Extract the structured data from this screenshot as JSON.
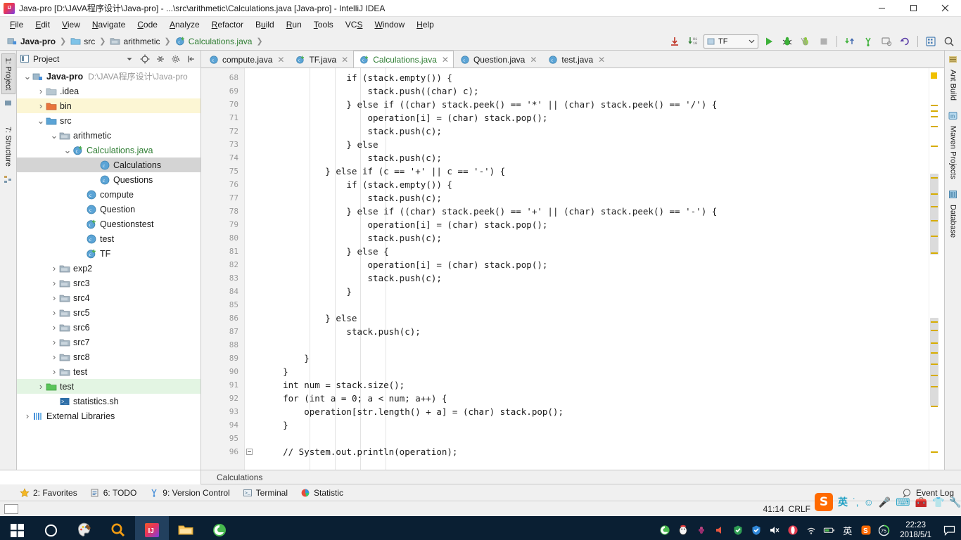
{
  "window": {
    "title": "Java-pro [D:\\JAVA程序设计\\Java-pro] - ...\\src\\arithmetic\\Calculations.java [Java-pro] - IntelliJ IDEA",
    "minimize": "–",
    "maximize": "□",
    "close": "✕"
  },
  "menu": [
    {
      "label": "File",
      "mnemonic": "F"
    },
    {
      "label": "Edit",
      "mnemonic": "E"
    },
    {
      "label": "View",
      "mnemonic": "V"
    },
    {
      "label": "Navigate",
      "mnemonic": "N"
    },
    {
      "label": "Code",
      "mnemonic": "C"
    },
    {
      "label": "Analyze",
      "mnemonic": "A"
    },
    {
      "label": "Refactor",
      "mnemonic": "R"
    },
    {
      "label": "Build",
      "mnemonic": "u"
    },
    {
      "label": "Run",
      "mnemonic": "R"
    },
    {
      "label": "Tools",
      "mnemonic": "T"
    },
    {
      "label": "VCS",
      "mnemonic": "S"
    },
    {
      "label": "Window",
      "mnemonic": "W"
    },
    {
      "label": "Help",
      "mnemonic": "H"
    }
  ],
  "breadcrumb": [
    {
      "label": "Java-pro",
      "icon": "module-icon"
    },
    {
      "label": "src",
      "icon": "source-folder-icon"
    },
    {
      "label": "arithmetic",
      "icon": "package-icon"
    },
    {
      "label": "Calculations.java",
      "icon": "java-class-icon"
    }
  ],
  "toolbar": {
    "run_config": "TF",
    "icons": [
      "update-project-icon",
      "compile-icon",
      "run-icon",
      "debug-icon",
      "coverage-icon",
      "stop-icon",
      "update-icon",
      "commit-icon",
      "history-icon",
      "rollback-icon",
      "settings-icon",
      "search-everywhere-icon"
    ]
  },
  "left_rail": [
    {
      "label": "1: Project",
      "active": true
    },
    {
      "label": "7: Structure",
      "active": false
    }
  ],
  "right_rail": [
    {
      "label": "Ant Build"
    },
    {
      "label": "Maven Projects"
    },
    {
      "label": "Database"
    }
  ],
  "project_panel": {
    "title": "Project",
    "tree": [
      {
        "indent": 0,
        "arrow": "v",
        "icon": "module-icon",
        "label": "Java-pro",
        "path": "D:\\JAVA程序设计\\Java-pro",
        "bold": true
      },
      {
        "indent": 1,
        "arrow": ">",
        "icon": "folder-icon",
        "label": ".idea"
      },
      {
        "indent": 1,
        "arrow": ">",
        "icon": "folder-orange-icon",
        "label": "bin",
        "highlight": "yellow"
      },
      {
        "indent": 1,
        "arrow": "v",
        "icon": "folder-blue-icon",
        "label": "src"
      },
      {
        "indent": 2,
        "arrow": "v",
        "icon": "package-icon",
        "label": "arithmetic"
      },
      {
        "indent": 3,
        "arrow": "v",
        "icon": "java-class-icon",
        "label": "Calculations.java",
        "green": true
      },
      {
        "indent": 5,
        "arrow": "",
        "icon": "class-icon",
        "label": "Calculations",
        "selected": true
      },
      {
        "indent": 5,
        "arrow": "",
        "icon": "class-icon",
        "label": "Questions"
      },
      {
        "indent": 4,
        "arrow": "",
        "icon": "class-icon",
        "label": "compute"
      },
      {
        "indent": 4,
        "arrow": "",
        "icon": "class-icon",
        "label": "Question"
      },
      {
        "indent": 4,
        "arrow": "",
        "icon": "java-class-icon",
        "label": "Questionstest"
      },
      {
        "indent": 4,
        "arrow": "",
        "icon": "class-icon",
        "label": "test"
      },
      {
        "indent": 4,
        "arrow": "",
        "icon": "java-class-icon",
        "label": "TF"
      },
      {
        "indent": 2,
        "arrow": ">",
        "icon": "package-icon",
        "label": "exp2"
      },
      {
        "indent": 2,
        "arrow": ">",
        "icon": "package-icon",
        "label": "src3"
      },
      {
        "indent": 2,
        "arrow": ">",
        "icon": "package-icon",
        "label": "src4"
      },
      {
        "indent": 2,
        "arrow": ">",
        "icon": "package-icon",
        "label": "src5"
      },
      {
        "indent": 2,
        "arrow": ">",
        "icon": "package-icon",
        "label": "src6"
      },
      {
        "indent": 2,
        "arrow": ">",
        "icon": "package-icon",
        "label": "src7"
      },
      {
        "indent": 2,
        "arrow": ">",
        "icon": "package-icon",
        "label": "src8"
      },
      {
        "indent": 2,
        "arrow": ">",
        "icon": "package-icon",
        "label": "test"
      },
      {
        "indent": 1,
        "arrow": ">",
        "icon": "folder-green-icon",
        "label": "test",
        "highlight": "green"
      },
      {
        "indent": 2,
        "arrow": "",
        "icon": "shell-script-icon",
        "label": "statistics.sh"
      },
      {
        "indent": 0,
        "arrow": ">",
        "icon": "library-icon",
        "label": "External Libraries"
      }
    ]
  },
  "editor_tabs": [
    {
      "label": "compute.java",
      "icon": "class-icon",
      "active": false
    },
    {
      "label": "TF.java",
      "icon": "java-class-icon",
      "active": false
    },
    {
      "label": "Calculations.java",
      "icon": "java-class-icon",
      "active": true,
      "green": true
    },
    {
      "label": "Question.java",
      "icon": "class-icon",
      "active": false
    },
    {
      "label": "test.java",
      "icon": "class-icon",
      "active": false
    }
  ],
  "code": {
    "first_line": 68,
    "lines": [
      {
        "n": 68,
        "html": "                <kw>if</kw> (stack.empty()) {"
      },
      {
        "n": 69,
        "html": "                    <hi>stack.push</hi>((<kw>char</kw>) c);"
      },
      {
        "n": 70,
        "html": "                } <kw>else if</kw> ((<kw>char</kw>) stack.peek() == <str>'*'</str> || (<kw>char</kw>) stack.peek() == <str>'/'</str>) {"
      },
      {
        "n": 71,
        "html": "                    operation[i] = (<kw>char</kw>) stack.pop();"
      },
      {
        "n": 72,
        "html": "                    <hi>stack.push</hi>(c);"
      },
      {
        "n": 73,
        "html": "                } <kw>else</kw>"
      },
      {
        "n": 74,
        "html": "                    <hi>stack.push</hi>(c);"
      },
      {
        "n": 75,
        "html": "            } <kw>else if</kw> (c == <str>'+'</str> || c == <str>'-'</str>) {"
      },
      {
        "n": 76,
        "html": "                <kw>if</kw> (stack.empty()) {"
      },
      {
        "n": 77,
        "html": "                    <hi>stack.push</hi>(c);"
      },
      {
        "n": 78,
        "html": "                } <kw>else if</kw> ((<kw>char</kw>) stack.peek() == <str>'+'</str> || (<kw>char</kw>) stack.peek() == <str>'-'</str>) {"
      },
      {
        "n": 79,
        "html": "                    operation[i] = (<kw>char</kw>) stack.pop();"
      },
      {
        "n": 80,
        "html": "                    <hi>stack.push</hi>(c);"
      },
      {
        "n": 81,
        "html": "                } <kw>else</kw> {"
      },
      {
        "n": 82,
        "html": "                    operation[i] = (<kw>char</kw>) stack.pop();"
      },
      {
        "n": 83,
        "html": "                    <hi>stack.push</hi>(c);"
      },
      {
        "n": 84,
        "html": "                }"
      },
      {
        "n": 85,
        "html": ""
      },
      {
        "n": 86,
        "html": "            } <kw>else</kw>"
      },
      {
        "n": 87,
        "html": "                <hi>stack.push</hi>(c);"
      },
      {
        "n": 88,
        "html": ""
      },
      {
        "n": 89,
        "html": "        }"
      },
      {
        "n": 90,
        "html": "    }"
      },
      {
        "n": 91,
        "html": "    <kw>int</kw> num = stack.size();"
      },
      {
        "n": 92,
        "html": "    <kw>for</kw> (<kw>int</kw> a = <num>0</num>; a < num; a++) {"
      },
      {
        "n": 93,
        "html": "        operation[str.length() + a] = (<kw>char</kw>) stack.pop();"
      },
      {
        "n": 94,
        "html": "    }"
      },
      {
        "n": 95,
        "html": ""
      },
      {
        "n": 96,
        "html": "    <cmt>// System.out.println(operation);</cmt>",
        "fold": true
      }
    ]
  },
  "under_editor": {
    "breadcrumb": "Calculations"
  },
  "tool_windows": [
    {
      "label": "2: Favorites",
      "mnemonic": "2",
      "icon": "star-icon"
    },
    {
      "label": "6: TODO",
      "mnemonic": "6",
      "icon": "todo-icon"
    },
    {
      "label": "9: Version Control",
      "mnemonic": "9",
      "icon": "vcs-icon"
    },
    {
      "label": "Terminal",
      "mnemonic": "",
      "icon": "terminal-icon"
    },
    {
      "label": "Statistic",
      "mnemonic": "",
      "icon": "statistic-icon"
    }
  ],
  "event_log": "Event Log",
  "status_bar": {
    "caret": "41:14",
    "line_separator": "CRLF"
  },
  "ime": {
    "logo": "S",
    "mode": "英"
  },
  "taskbar": {
    "apps": [
      "start-icon",
      "cortana-icon",
      "paint-icon",
      "search-icon",
      "intellij-icon",
      "explorer-icon",
      "browser-icon"
    ],
    "tray": [
      "browser-icon",
      "qq-icon",
      "grape-icon",
      "volume-icon",
      "360-shield-icon",
      "security-icon",
      "mute-icon",
      "opera-icon",
      "wifi-icon",
      "battery-icon"
    ],
    "ime_label": "英",
    "sogou_label": "S",
    "accel_value": "75",
    "time": "22:23",
    "date": "2018/5/1"
  },
  "colors": {
    "accent_green": "#2e7d32",
    "keyword_blue": "#00008f",
    "string_green": "#008000",
    "highlight_yellow": "#fbeeb6",
    "selection_gray": "#d4d4d4",
    "taskbar_bg": "#0a1f33"
  }
}
